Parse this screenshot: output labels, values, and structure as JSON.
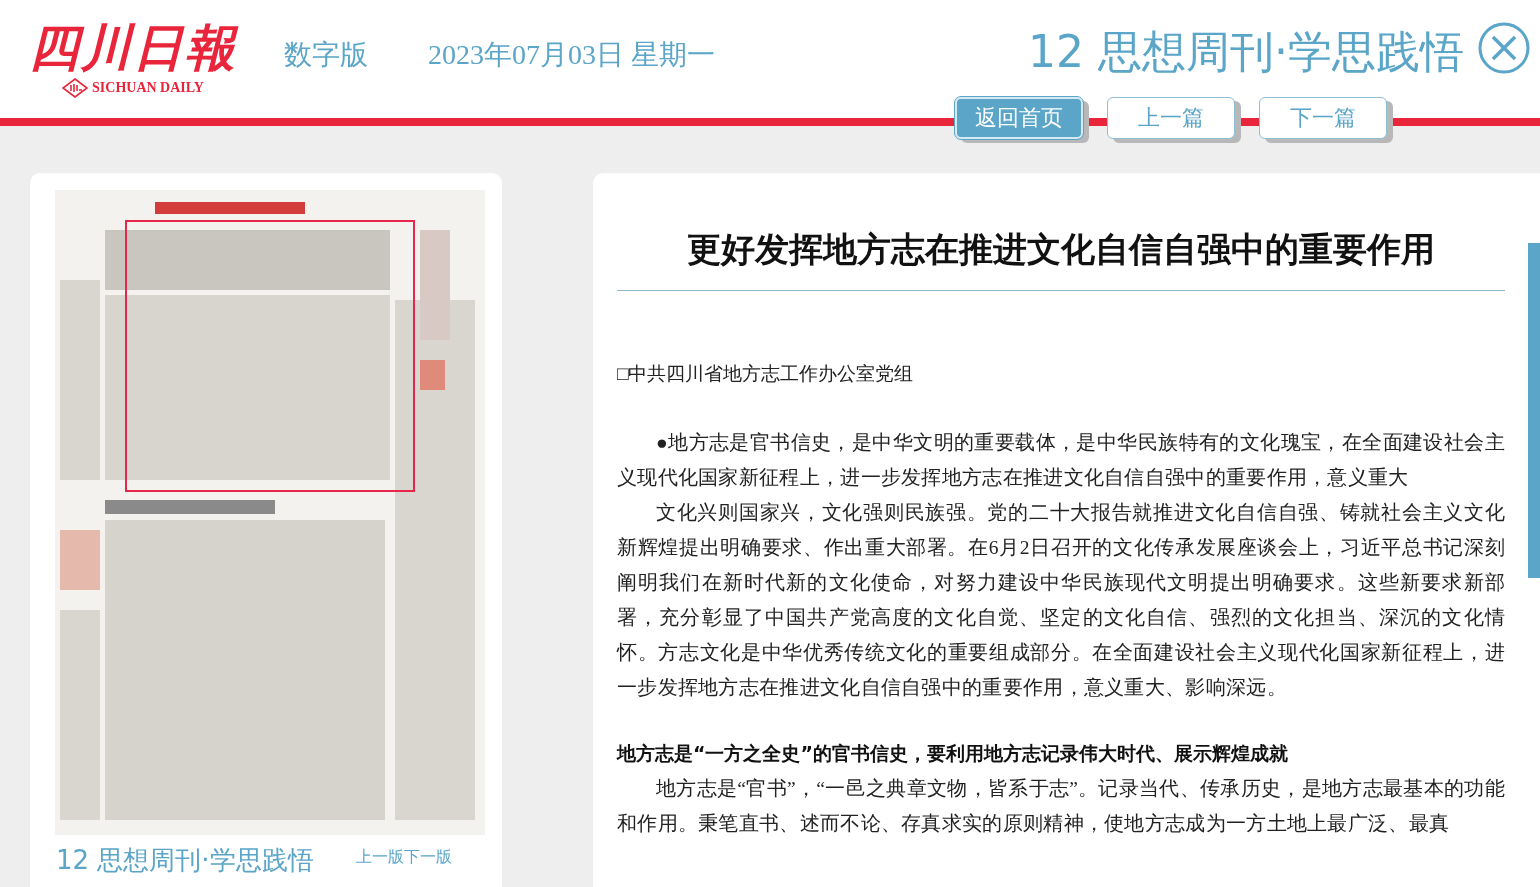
{
  "header": {
    "logo": "四川日報",
    "logo_subtitle": "SICHUAN DAILY",
    "edition": "数字版",
    "date": "2023年07月03日 星期一",
    "page_title": "12 思想周刊·学思践悟"
  },
  "nav_buttons": [
    {
      "label": "返回首页",
      "kind": "primary"
    },
    {
      "label": "上一篇",
      "kind": "normal"
    },
    {
      "label": "下一篇",
      "kind": "normal"
    }
  ],
  "page_panel": {
    "page_name": "12 思想周刊·学思践悟",
    "links": [
      "上一版",
      "下一版"
    ]
  },
  "article": {
    "title": "更好发挥地方志在推进文化自信自强中的重要作用",
    "byline": "□中共四川省地方志工作办公室党组",
    "paragraphs": [
      {
        "kind": "text",
        "text": "●地方志是官书信史，是中华文明的重要载体，是中华民族特有的文化瑰宝，在全面建设社会主义现代化国家新征程上，进一步发挥地方志在推进文化自信自强中的重要作用，意义重大"
      },
      {
        "kind": "text",
        "text": "文化兴则国家兴，文化强则民族强。党的二十大报告就推进文化自信自强、铸就社会主义文化新辉煌提出明确要求、作出重大部署。在6月2日召开的文化传承发展座谈会上，习近平总书记深刻阐明我们在新时代新的文化使命，对努力建设中华民族现代文明提出明确要求。这些新要求新部署，充分彰显了中国共产党高度的文化自觉、坚定的文化自信、强烈的文化担当、深沉的文化情怀。方志文化是中华优秀传统文化的重要组成部分。在全面建设社会主义现代化国家新征程上，进一步发挥地方志在推进文化自信自强中的重要作用，意义重大、影响深远。"
      },
      {
        "kind": "heading",
        "text": "地方志是“一方之全史”的官书信史，要利用地方志记录伟大时代、展示辉煌成就"
      },
      {
        "kind": "text",
        "text": "地方志是“官书”，“一邑之典章文物，皆系于志”。记录当代、传承历史，是地方志最基本的功能和作用。秉笔直书、述而不论、存真求实的原则精神，使地方志成为一方土地上最广泛、最真"
      }
    ]
  }
}
